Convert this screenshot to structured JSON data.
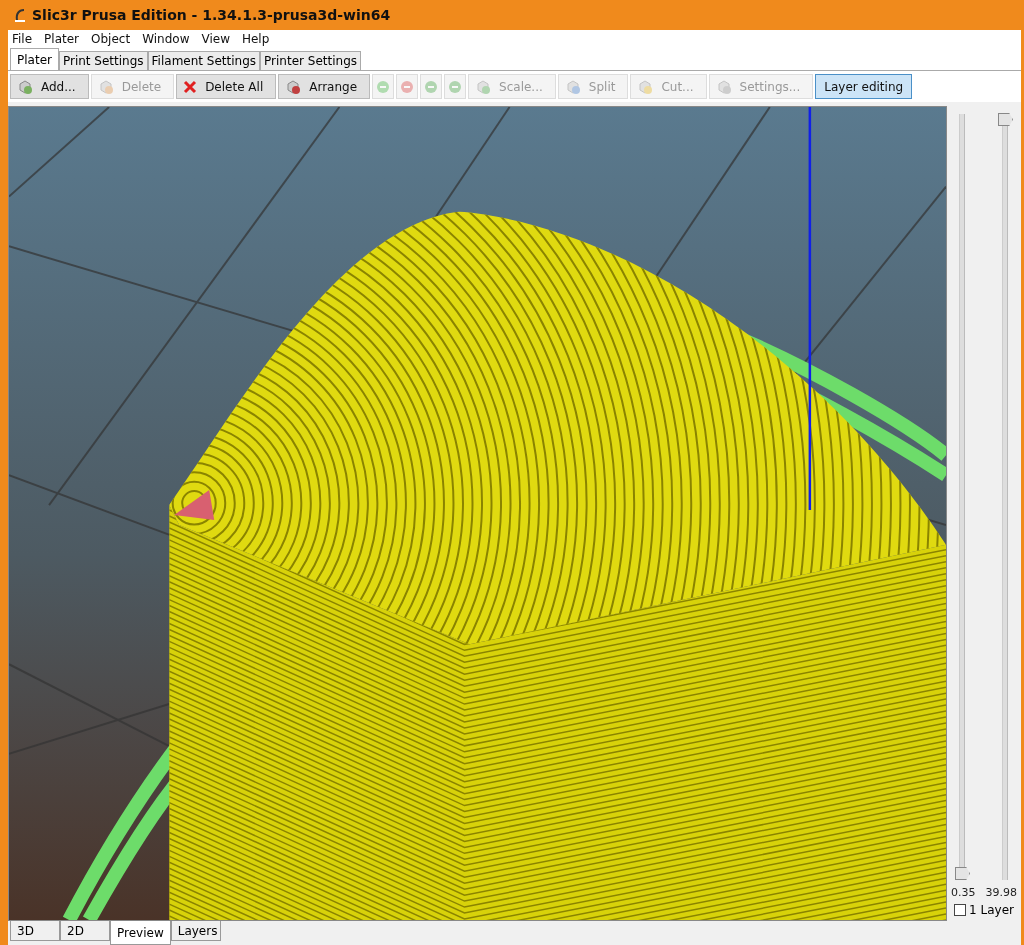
{
  "window": {
    "title": "Slic3r Prusa Edition - 1.34.1.3-prusa3d-win64"
  },
  "menu": [
    "File",
    "Plater",
    "Object",
    "Window",
    "View",
    "Help"
  ],
  "tabs": [
    {
      "label": "Plater",
      "selected": true
    },
    {
      "label": "Print Settings",
      "selected": false
    },
    {
      "label": "Filament Settings",
      "selected": false
    },
    {
      "label": "Printer Settings",
      "selected": false
    }
  ],
  "toolbar": [
    {
      "kind": "text",
      "label": "Add...",
      "disabled": false,
      "pressed": false
    },
    {
      "kind": "text",
      "label": "Delete",
      "disabled": true,
      "pressed": false
    },
    {
      "kind": "text",
      "label": "Delete All",
      "disabled": false,
      "pressed": false
    },
    {
      "kind": "text",
      "label": "Arrange",
      "disabled": false,
      "pressed": false
    },
    {
      "kind": "icon",
      "disabled": true,
      "pressed": false
    },
    {
      "kind": "icon",
      "disabled": true,
      "pressed": false
    },
    {
      "kind": "icon",
      "disabled": true,
      "pressed": false
    },
    {
      "kind": "icon",
      "disabled": true,
      "pressed": false
    },
    {
      "kind": "text",
      "label": "Scale...",
      "disabled": true,
      "pressed": false
    },
    {
      "kind": "text",
      "label": "Split",
      "disabled": true,
      "pressed": false
    },
    {
      "kind": "text",
      "label": "Cut...",
      "disabled": true,
      "pressed": false
    },
    {
      "kind": "text",
      "label": "Settings...",
      "disabled": true,
      "pressed": false
    },
    {
      "kind": "text",
      "label": "Layer editing",
      "disabled": false,
      "pressed": true
    }
  ],
  "layer_sliders": [
    {
      "level": 0,
      "reading": "0.35"
    },
    {
      "level": 1,
      "reading": "39.98"
    }
  ],
  "one_layer": {
    "label": "1 Layer",
    "checked": false
  },
  "view_tabs": [
    {
      "label": "3D",
      "selected": false
    },
    {
      "label": "2D",
      "selected": false
    },
    {
      "label": "Preview",
      "selected": true
    },
    {
      "label": "Layers",
      "selected": false
    }
  ]
}
